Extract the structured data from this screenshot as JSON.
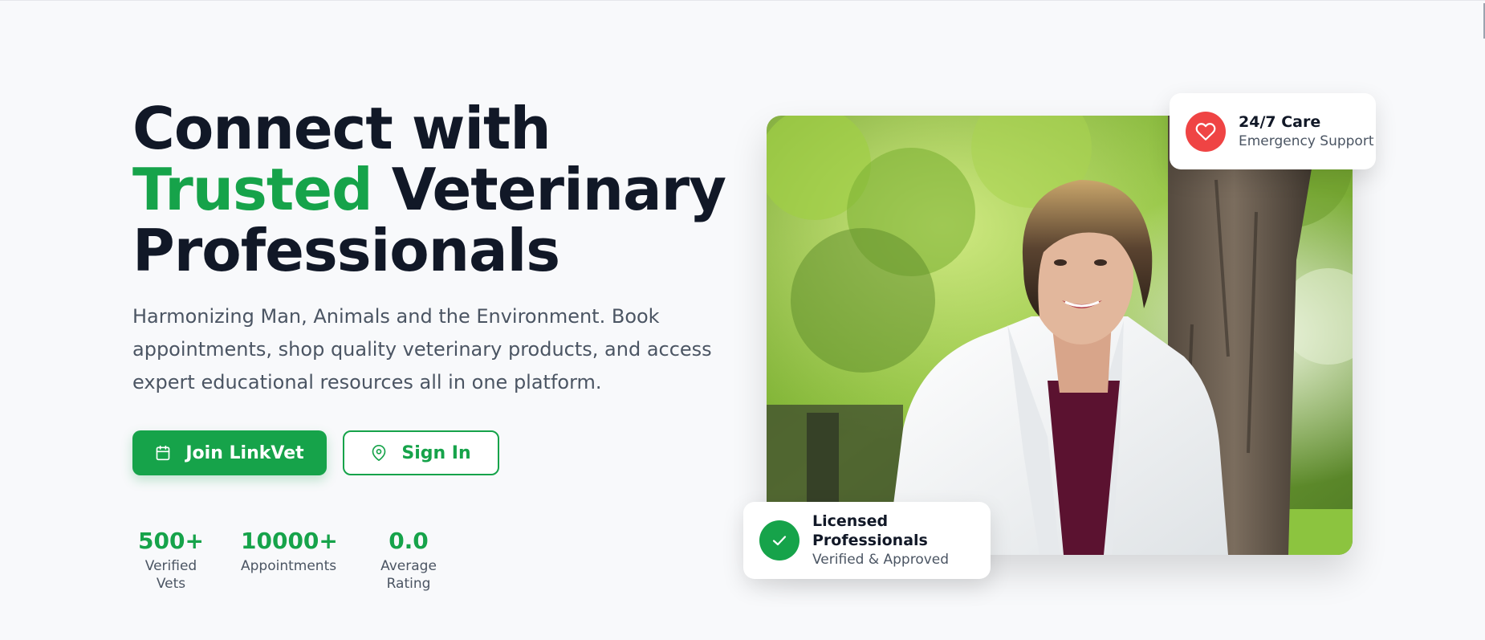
{
  "hero": {
    "title_line1": "Connect with",
    "title_accent": "Trusted",
    "title_line2_rest": " Veterinary",
    "title_line3": "Professionals",
    "description": "Harmonizing Man, Animals and the Environment. Book appointments, shop quality veterinary products, and access expert educational resources all in one platform."
  },
  "buttons": {
    "join_label": "Join LinkVet",
    "join_icon": "calendar-icon",
    "signin_label": "Sign In",
    "signin_icon": "map-pin-icon"
  },
  "stats": [
    {
      "value": "500+",
      "label": "Verified Vets"
    },
    {
      "value": "10000+",
      "label": "Appointments"
    },
    {
      "value": "0.0",
      "label": "Average Rating"
    }
  ],
  "cards": {
    "care": {
      "title": "24/7 Care",
      "subtitle": "Emergency Support",
      "icon": "heart-icon"
    },
    "licensed": {
      "title": "Licensed Professionals",
      "subtitle": "Verified & Approved",
      "icon": "check-icon"
    }
  },
  "colors": {
    "accent": "#16a34a",
    "heading": "#111827",
    "body_text": "#4b5563",
    "care_icon_bg": "#ef4444",
    "background": "#f8f9fb"
  }
}
